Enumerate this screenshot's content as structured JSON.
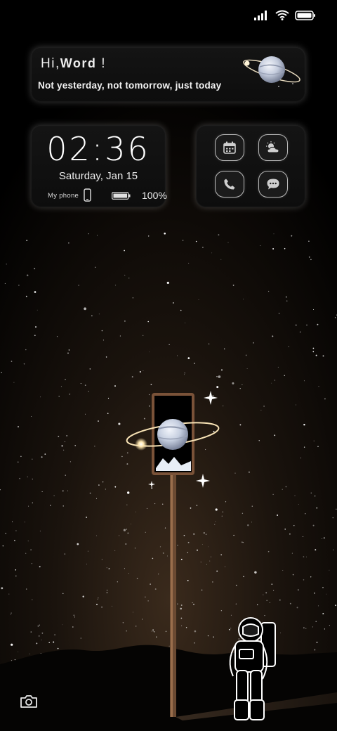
{
  "status_bar": {
    "signal_icon": "signal-icon",
    "wifi_icon": "wifi-icon",
    "battery_icon": "battery-icon"
  },
  "greeting_widget": {
    "hi_prefix": "Hi,",
    "name": "Word",
    "exclamation": "!",
    "subtitle": "Not yesterday, not tomorrow, just today",
    "icon": "planet-icon"
  },
  "clock_widget": {
    "time": "02:36",
    "date": "Saturday, Jan 15",
    "phone_label": "My phone",
    "phone_icon": "smartphone-icon",
    "battery_icon": "battery-icon",
    "battery_percent": "100%",
    "battery_level": 1.0
  },
  "shortcuts_widget": {
    "items": [
      {
        "name": "calendar",
        "icon": "calendar-icon"
      },
      {
        "name": "weather",
        "icon": "weather-icon"
      },
      {
        "name": "phone",
        "icon": "phone-icon"
      },
      {
        "name": "messages",
        "icon": "message-icon"
      }
    ]
  },
  "lock_screen": {
    "camera_icon": "camera-icon"
  },
  "wallpaper": {
    "theme": "astronaut under starry sky with framed planet on a pole"
  },
  "colors": {
    "background": "#000000",
    "panel": "#111111",
    "panel_glow": "#ffffff",
    "frame_wood": "#8a5a3a",
    "planet": "#c8d4ea",
    "text": "#ffffff"
  }
}
